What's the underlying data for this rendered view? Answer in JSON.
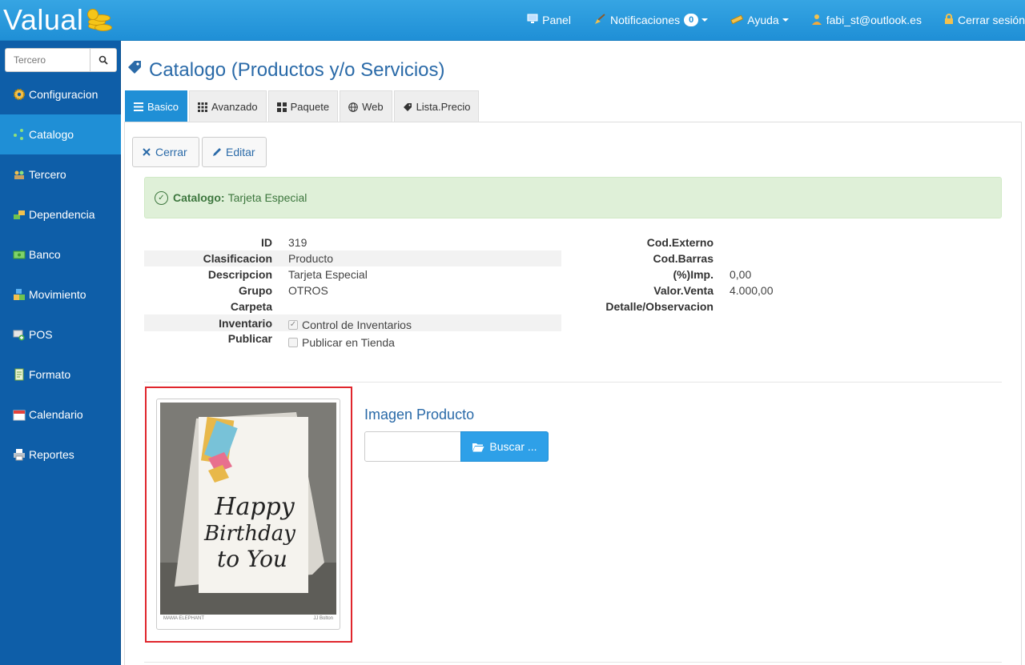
{
  "app": {
    "logo": "Valual"
  },
  "topnav": {
    "panel": "Panel",
    "notificaciones": "Notificaciones",
    "notif_count": "0",
    "ayuda": "Ayuda",
    "user": "fabi_st@outlook.es",
    "logout": "Cerrar sesión"
  },
  "sidebar": {
    "search_placeholder": "Tercero",
    "items": [
      {
        "label": "Configuracion",
        "icon": "gear-icon"
      },
      {
        "label": "Catalogo",
        "icon": "catalog-icon",
        "active": true
      },
      {
        "label": "Tercero",
        "icon": "people-icon"
      },
      {
        "label": "Dependencia",
        "icon": "building-icon"
      },
      {
        "label": "Banco",
        "icon": "money-icon"
      },
      {
        "label": "Movimiento",
        "icon": "boxes-icon"
      },
      {
        "label": "POS",
        "icon": "cart-icon"
      },
      {
        "label": "Formato",
        "icon": "document-icon"
      },
      {
        "label": "Calendario",
        "icon": "calendar-icon"
      },
      {
        "label": "Reportes",
        "icon": "printer-icon"
      }
    ]
  },
  "page": {
    "title": "Catalogo (Productos y/o Servicios)"
  },
  "tabs": [
    {
      "label": "Basico",
      "active": true
    },
    {
      "label": "Avanzado"
    },
    {
      "label": "Paquete"
    },
    {
      "label": "Web"
    },
    {
      "label": "Lista.Precio"
    }
  ],
  "actions": {
    "cerrar": "Cerrar",
    "editar": "Editar"
  },
  "alert": {
    "label": "Catalogo:",
    "value": "Tarjeta Especial"
  },
  "details_left": [
    {
      "label": "ID",
      "value": "319"
    },
    {
      "label": "Clasificacion",
      "value": "Producto"
    },
    {
      "label": "Descripcion",
      "value": "Tarjeta Especial"
    },
    {
      "label": "Grupo",
      "value": "OTROS"
    },
    {
      "label": "Carpeta",
      "value": ""
    },
    {
      "label": "Inventario",
      "value": "Control de Inventarios",
      "checked": true
    },
    {
      "label": "Publicar",
      "value": "Publicar en Tienda",
      "checked": false
    }
  ],
  "details_right": [
    {
      "label": "Cod.Externo",
      "value": ""
    },
    {
      "label": "Cod.Barras",
      "value": ""
    },
    {
      "label": "(%)Imp.",
      "value": "0,00"
    },
    {
      "label": "Valor.Venta",
      "value": "4.000,00"
    },
    {
      "label": "Detalle/Observacion",
      "value": ""
    }
  ],
  "image": {
    "title": "Imagen Producto",
    "buscar": "Buscar ...",
    "card_text": [
      "Happy",
      "Birthday",
      "to You"
    ],
    "caption_left": "MAMA ELEPHANT",
    "caption_right": "JJ Bolton"
  }
}
